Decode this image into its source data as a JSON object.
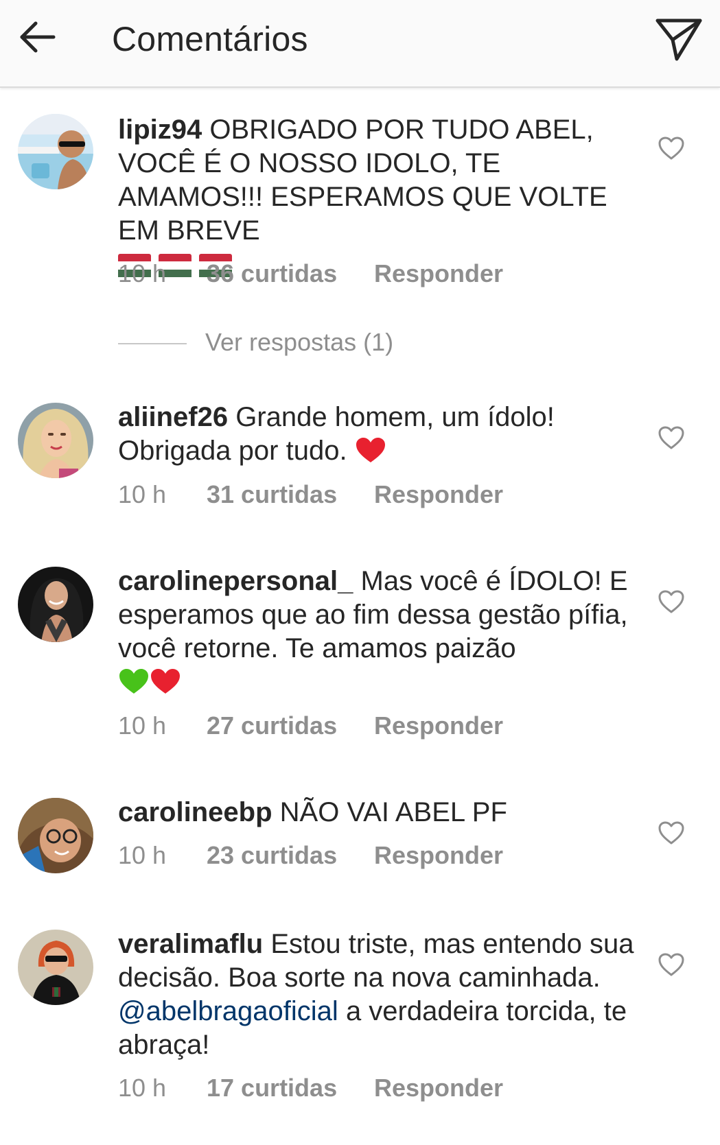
{
  "header": {
    "title": "Comentários",
    "back_icon": "arrow-left-icon",
    "share_icon": "paper-plane-icon"
  },
  "replies_link": "Ver respostas (1)",
  "comments": [
    {
      "username": "lipiz94",
      "text": "OBRIGADO POR TUDO ABEL, VOCÊ É O NOSSO IDOLO, TE AMAMOS!!! ESPERAMOS QUE VOLTE EM BREVE",
      "emojis": [
        "🇭🇺",
        "🇭🇺",
        "🇭🇺"
      ],
      "time": "10 h",
      "likes": "36 curtidas",
      "reply": "Responder"
    },
    {
      "username": "aliinef26",
      "text": "Grande homem, um ídolo! Obrigada por tudo.",
      "emojis": [
        "❤️"
      ],
      "time": "10 h",
      "likes": "31 curtidas",
      "reply": "Responder"
    },
    {
      "username": "carolinepersonal_",
      "text": "Mas você é ÍDOLO! E esperamos que ao fim dessa gestão pífia, você retorne. Te amamos paizão",
      "emojis": [
        "💚",
        "❤️"
      ],
      "time": "10 h",
      "likes": "27 curtidas",
      "reply": "Responder"
    },
    {
      "username": "carolineebp",
      "text": "NÃO VAI ABEL PF",
      "time": "10 h",
      "likes": "23 curtidas",
      "reply": "Responder"
    },
    {
      "username": "veralimaflu",
      "text_before": "Estou triste, mas entendo sua decisão. Boa sorte na nova caminhada.",
      "mention": "@abelbragaoficial",
      "text_after": "a verdadeira torcida, te abraça!",
      "time": "10 h",
      "likes": "17 curtidas",
      "reply": "Responder"
    }
  ],
  "colors": {
    "text": "#262626",
    "meta": "#8e8e8e",
    "mention": "#003569",
    "header_bg": "#fafafa"
  }
}
